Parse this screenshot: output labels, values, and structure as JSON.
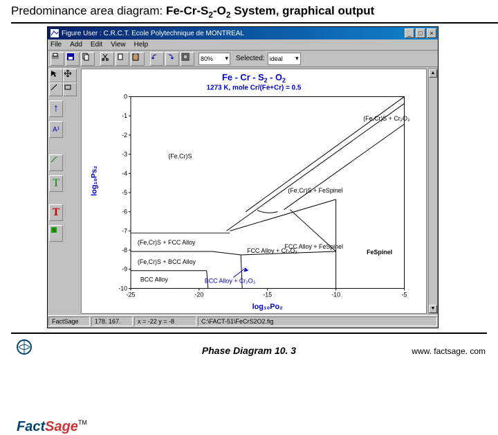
{
  "slide": {
    "title_prefix": "Predominance area diagram: ",
    "title_bold_1": "Fe-Cr-S",
    "title_bold_2": "-O",
    "title_bold_3": " System, graphical output"
  },
  "win": {
    "title": "Figure    User : C.R.C.T.  Ecole Polytechnique de MONTREAL",
    "btn_min": "_",
    "btn_max": "□",
    "btn_close": "×"
  },
  "menu": {
    "file": "File",
    "add": "Add",
    "edit": "Edit",
    "view": "View",
    "help": "Help"
  },
  "toolbar": {
    "zoom": "80%",
    "selected_label": "Selected:",
    "ideal": "ideal"
  },
  "chart": {
    "title1": "Fe - Cr - S",
    "title2": " - O",
    "subtitle": "1273 K,  mole Cr/(Fe+Cr) = 0.5",
    "xlabel": "log₁₀Po₂",
    "ylabel": "log₁₀Ps₂",
    "xtick_min": "-25",
    "xtick_1": "-20",
    "xtick_2": "-15",
    "xtick_3": "-10",
    "xtick_max": "-5",
    "ytick_0": "0",
    "ytick_m1": "-1",
    "ytick_m2": "-2",
    "ytick_m3": "-3",
    "ytick_m4": "-4",
    "ytick_m5": "-5",
    "ytick_m6": "-6",
    "ytick_m7": "-7",
    "ytick_m8": "-8",
    "ytick_m9": "-9",
    "ytick_m10": "-10",
    "region_topright": "(Fe,Cr)S + Cr₂O₃",
    "region_lefttop": "(Fe,Cr)S",
    "region_mid": "(Fe,Cr)S + FeSpinel",
    "region_right": "FeSpinel",
    "region_midright": "FCC Alloy + FeSpinel",
    "region_midleft": "(Fe,Cr)S + FCC Alloy",
    "region_centerbottom": "FCC Alloy + Cr₂O₃",
    "region_lowermid": "(Fe,Cr)S + BCC Alloy",
    "region_bottomleft": "BCC Alloy",
    "region_bottommid": "BCC Alloy + Cr₂O₃"
  },
  "status": {
    "c1": "FactSage",
    "c2": "178. 167.",
    "c3": "x = -22  y = -8",
    "c4": "C:\\FACT-51\\FeCrS2O2.fig"
  },
  "footer": {
    "label": "Phase Diagram  10. 3",
    "url": "www. factsage. com",
    "logo_fact": "Fact",
    "logo_sage": "Sage",
    "tm": "TM"
  },
  "palette": {
    "arrow": "↖",
    "up": "↑",
    "A1": "A¹",
    "T1": "T",
    "T2": "T"
  }
}
